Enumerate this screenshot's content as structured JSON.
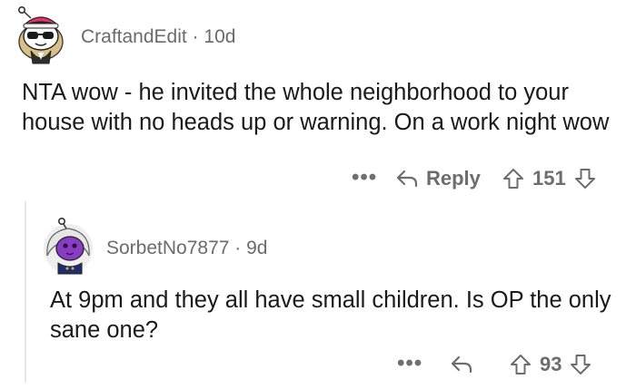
{
  "comments": [
    {
      "author": "CraftandEdit",
      "separator": "·",
      "age": "10d",
      "body": "NTA wow - he invited the whole neighborhood to your house with no heads up or warning. On a work night wow",
      "more": "•••",
      "reply_label": "Reply",
      "score": "151"
    },
    {
      "author": "SorbetNo7877",
      "separator": "·",
      "age": "9d",
      "body": "At 9pm and they all have small children. Is OP the only sane one?",
      "more": "•••",
      "reply_label": "",
      "score": "93"
    }
  ],
  "icons": {
    "avatar1": "snoo-avatar-pink-hat-sunglasses",
    "avatar2": "snoo-avatar-purple-white-hair",
    "reply": "reply-arrow-icon",
    "upvote": "upvote-arrow-icon",
    "downvote": "downvote-arrow-icon"
  },
  "colors": {
    "text": "#1a1a1a",
    "meta": "#6b6b6b",
    "thread_line": "#e6e6e6"
  }
}
